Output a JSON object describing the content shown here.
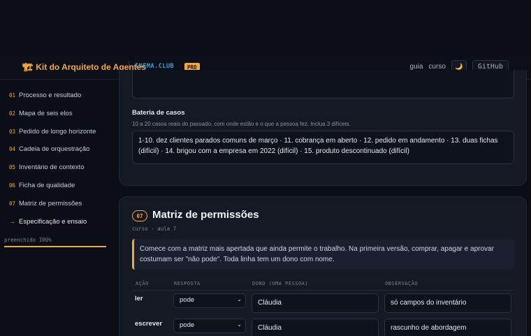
{
  "header": {
    "brand_icon": "🏗",
    "brand": "Kit do Arquiteto de Agentes",
    "club": "INEMA.CLUB",
    "pro": "PRO",
    "nav": {
      "guide": "guia",
      "course": "curso",
      "theme_icon": "🌙",
      "github": "GitHub"
    }
  },
  "sidebar": {
    "items": [
      {
        "num": "01",
        "label": "Processo e resultado"
      },
      {
        "num": "02",
        "label": "Mapa de seis elos"
      },
      {
        "num": "03",
        "label": "Pedido de longo horizonte"
      },
      {
        "num": "04",
        "label": "Cadeia de orquestração"
      },
      {
        "num": "05",
        "label": "Inventário de contexto"
      },
      {
        "num": "06",
        "label": "Ficha de qualidade"
      },
      {
        "num": "07",
        "label": "Matriz de permissões"
      },
      {
        "num": "→",
        "label": "Especificação e ensaio"
      }
    ],
    "progress_label": "preenchido 100%",
    "progress": 1.0
  },
  "cases": {
    "label": "Bateria de casos",
    "hint": "10 a 20 casos reais do passado, com onde estão e o que a pessoa fez. Inclua 3 difíceis.",
    "value": "1-10. dez clientes parados comuns de março · 11. cobrança em aberto · 12. pedido em andamento · 13. duas fichas (difícil) · 14. brigou com a empresa em 2022 (difícil) · 15. produto descontinuado (difícil)"
  },
  "section": {
    "num": "07",
    "title": "Matriz de permissões",
    "meta": "curso · aula 7",
    "callout": "Comece com a matriz mais apertada que ainda permite o trabalho. Na primeira versão, comprar, apagar e aprovar costumam ser \"não pode\". Toda linha tem um dono com nome.",
    "columns": {
      "action": "AÇÃO",
      "answer": "RESPOSTA",
      "owner": "DONO (UMA PESSOA)",
      "note": "OBSERVAÇÃO"
    },
    "rows": [
      {
        "action": "ler",
        "answer": "pode",
        "owner": "Cláudia",
        "note": "só campos do inventário"
      },
      {
        "action": "escrever",
        "answer": "pode",
        "owner": "Cláudia",
        "note": "rascunho de abordagem"
      }
    ]
  }
}
